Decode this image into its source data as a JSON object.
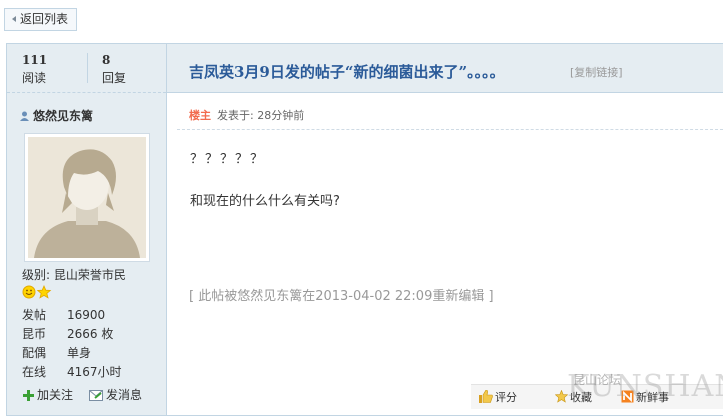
{
  "nav": {
    "back_label": "返回列表"
  },
  "stats": {
    "views_count": "111",
    "views_label": "阅读",
    "replies_count": "8",
    "replies_label": "回复"
  },
  "thread": {
    "title": "吉凤英3月9日发的帖子“新的细菌出来了”。。。。",
    "copy_link_label": "[复制链接]"
  },
  "author": {
    "name": "悠然见东篱",
    "level_label": "级别: 昆山荣誉市民",
    "info": [
      {
        "key": "发帖",
        "value": "16900"
      },
      {
        "key": "昆币",
        "value": "2666 枚"
      },
      {
        "key": "配偶",
        "value": "单身"
      },
      {
        "key": "在线",
        "value": "4167小时"
      }
    ],
    "follow_label": "加关注",
    "message_label": "发消息"
  },
  "post": {
    "owner_badge": "楼主",
    "posted_at": "发表于: 28分钟前",
    "line1": "？？？？？",
    "line2": "和现在的什么什么有关吗?",
    "edit_note": "[ 此帖被悠然见东篱在2013-04-02 22:09重新编辑 ]"
  },
  "actions": {
    "rate_label": "评分",
    "favorite_label": "收藏",
    "fresh_label": "新鲜事"
  },
  "watermark": {
    "big": "KUNSHAN BBS",
    "small": "昆山论坛"
  },
  "colors": {
    "accent": "#2b5b99",
    "sidebar_bg": "#e5edf2",
    "border": "#c2d5e3",
    "owner": "#f26c4f"
  },
  "icons": [
    "back-arrow-icon",
    "user-icon",
    "smiley-icon",
    "star-icon",
    "plus-icon",
    "mail-icon",
    "thumbs-up-icon"
  ]
}
